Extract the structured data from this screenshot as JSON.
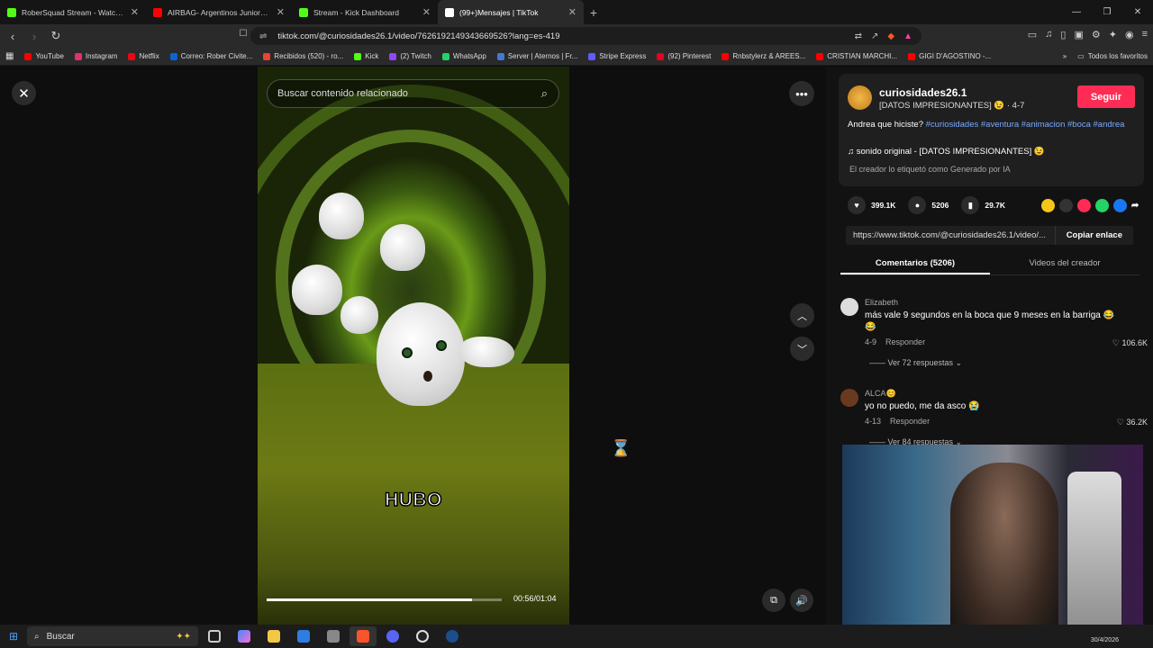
{
  "browser": {
    "tabs": [
      {
        "label": "RoberSquad Stream - Watch Live",
        "color": "#53fc18"
      },
      {
        "label": "AIRBAG- Argentinos Juniors - EN VIVO",
        "color": "#ff0000"
      },
      {
        "label": "Stream - Kick Dashboard",
        "color": "#53fc18"
      },
      {
        "label": "(99+)Mensajes | TikTok",
        "color": "#ffffff",
        "active": true
      }
    ],
    "url": "tiktok.com/@curiosidades26.1/video/7626192149343669526?lang=es-419",
    "bookmarks": [
      {
        "label": "YouTube",
        "color": "#ff0000"
      },
      {
        "label": "Instagram",
        "color": "#e1306c"
      },
      {
        "label": "Netflix",
        "color": "#e50914"
      },
      {
        "label": "Correo: Rober Civite...",
        "color": "#0a64d6"
      },
      {
        "label": "Recibidos (520) - ro...",
        "color": "#ea4335"
      },
      {
        "label": "Kick",
        "color": "#53fc18"
      },
      {
        "label": "(2) Twitch",
        "color": "#9146ff"
      },
      {
        "label": "WhatsApp",
        "color": "#25d366"
      },
      {
        "label": "Server | Aternos | Fr...",
        "color": "#3f7bd4"
      },
      {
        "label": "Stripe Express",
        "color": "#635bff"
      },
      {
        "label": "(92) Pinterest",
        "color": "#e60023"
      },
      {
        "label": "Rnbstylerz & AREES...",
        "color": "#ff0000"
      },
      {
        "label": "CRISTIAN MARCHI...",
        "color": "#ff0000"
      },
      {
        "label": "GIGI D'AGOSTINO -...",
        "color": "#ff0000"
      }
    ],
    "all_bookmarks": "Todos los favoritos"
  },
  "video": {
    "search_placeholder": "Buscar contenido relacionado",
    "caption": "HUBO",
    "time": "00:56/01:04",
    "progress": 0.875
  },
  "creator": {
    "username": "curiosidades26.1",
    "subtitle": "[DATOS IMPRESIONANTES] 😉 · 4-7",
    "follow": "Seguir",
    "description_text": "Andrea que hiciste? ",
    "description_tags": "#curiosidades #aventura #animacion #boca #andrea",
    "music": "♫  sonido original - [DATOS IMPRESIONANTES] 😉",
    "ai_label": "El creador lo etiquetó como Generado por IA"
  },
  "stats": {
    "likes": "399.1K",
    "comments": "5206",
    "saves": "29.7K"
  },
  "link": {
    "url": "https://www.tiktok.com/@curiosidades26.1/video/...",
    "copy": "Copiar enlace"
  },
  "panel_tabs": {
    "comments": "Comentarios (5206)",
    "creator_videos": "Videos del creador"
  },
  "comments": [
    {
      "author": "Elizabeth",
      "text": "más vale 9 segundos en la boca que 9 meses en la barriga 😂😂",
      "date": "4-9",
      "reply": "Responder",
      "likes": "♡ 106.6K",
      "more": "—— Ver 72 respuestas ⌄"
    },
    {
      "author": "ALCA😊",
      "text": "yo no puedo, me da asco 😭",
      "date": "4-13",
      "reply": "Responder",
      "likes": "♡ 36.2K",
      "more": "—— Ver 84 respuestas ⌄"
    }
  ],
  "taskbar": {
    "search": "Buscar",
    "date": "30/4/2026"
  }
}
